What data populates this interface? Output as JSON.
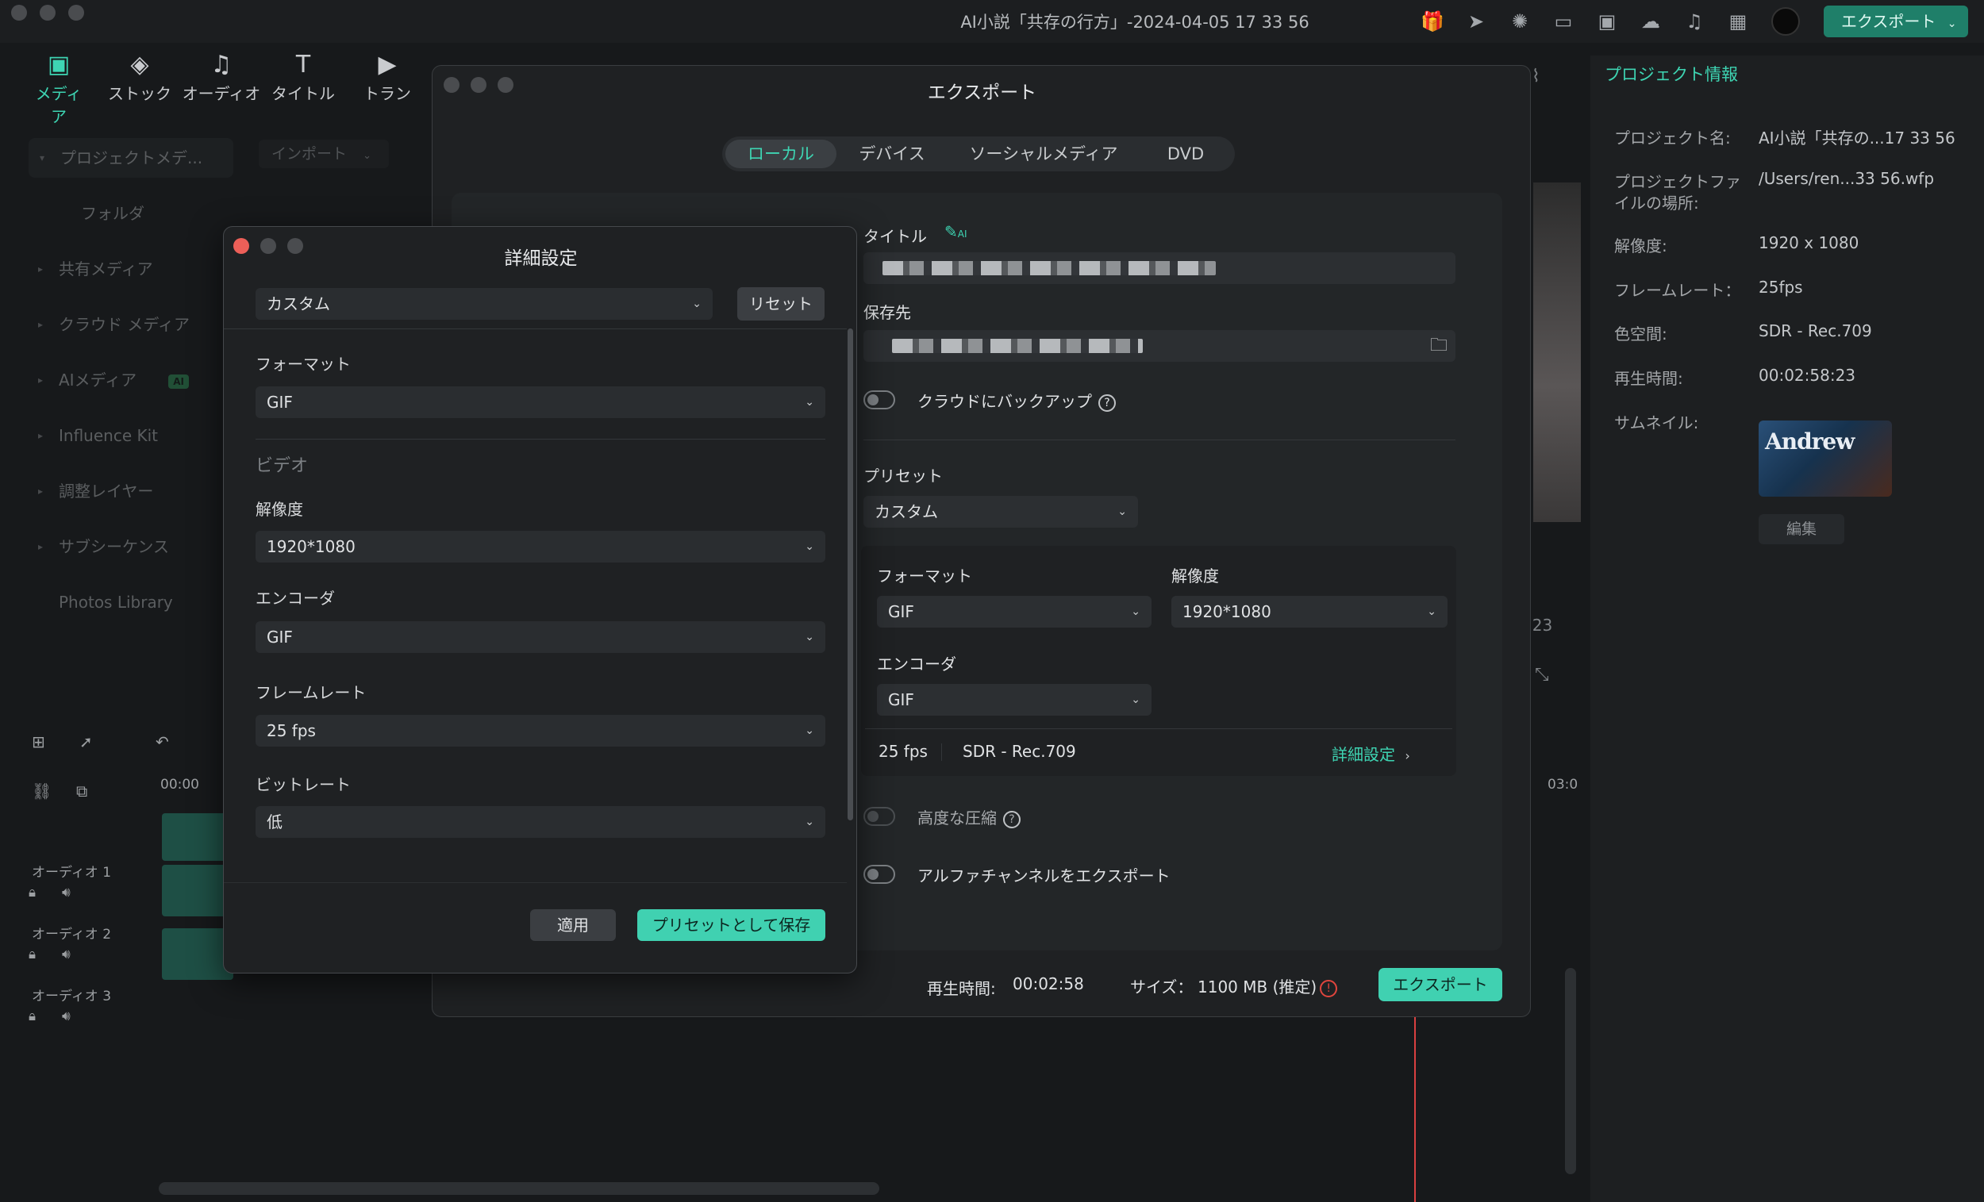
{
  "app": {
    "title": "AI小説「共存の行方」-2024-04-05 17 33 56",
    "export_button": "エクスポート",
    "toolbar": [
      {
        "label": "メディア",
        "icon": "media-icon"
      },
      {
        "label": "ストック",
        "icon": "stock-icon"
      },
      {
        "label": "オーディオ",
        "icon": "audio-icon"
      },
      {
        "label": "タイトル",
        "icon": "title-icon"
      },
      {
        "label": "トラン",
        "icon": "transition-icon"
      }
    ]
  },
  "left_panel": {
    "items": [
      "プロジェクトメデ...",
      "フォルダ",
      "共有メディア",
      "クラウド メディア",
      "AIメディア",
      "Influence Kit",
      "調整レイヤー",
      "サブシーケンス",
      "Photos Library"
    ],
    "ai_badge": "AI",
    "import_button": "インポート"
  },
  "right_panel": {
    "tab": "プロジェクト情報",
    "rows": [
      {
        "label": "プロジェクト名:",
        "value": "AI小説「共存の...17 33 56"
      },
      {
        "label": "プロジェクトファ",
        "value": "/Users/ren...33 56.wfp"
      },
      {
        "label": "イルの場所:",
        "value": ""
      },
      {
        "label": "解像度:",
        "value": "1920 x 1080"
      },
      {
        "label": "フレームレート：",
        "value": "25fps"
      },
      {
        "label": "色空間:",
        "value": "SDR - Rec.709"
      },
      {
        "label": "再生時間:",
        "value": "00:02:58:23"
      },
      {
        "label": "サムネイル:",
        "value": ""
      }
    ],
    "thumbnail_text": "Andrew",
    "edit_button": "編集",
    "preview_time": ":23"
  },
  "timeline": {
    "ruler_start": "00:00",
    "ruler_end": "03:0",
    "tracks": [
      "オーディオ 1",
      "オーディオ 2",
      "オーディオ 3"
    ]
  },
  "export_dialog": {
    "title": "エクスポート",
    "tabs": [
      "ローカル",
      "デバイス",
      "ソーシャルメディア",
      "DVD"
    ],
    "active_tab": 0,
    "title_label": "タイトル",
    "save_to_label": "保存先",
    "cloud_backup_label": "クラウドにバックアップ",
    "preset_label": "プリセット",
    "preset_value": "カスタム",
    "format_label": "フォーマット",
    "format_value": "GIF",
    "resolution_label": "解像度",
    "resolution_value": "1920*1080",
    "encoder_label": "エンコーダ",
    "encoder_value": "GIF",
    "summary_fps": "25 fps",
    "summary_color": "SDR - Rec.709",
    "detail_link": "詳細設定",
    "advanced_compression": "高度な圧縮",
    "alpha_export": "アルファチャンネルをエクスポート",
    "duration_label": "再生時間:",
    "duration_value": "00:02:58",
    "size_label": "サイズ：",
    "size_value": "1100 MB (推定)",
    "export_button": "エクスポート"
  },
  "detail_dialog": {
    "title": "詳細設定",
    "preset_value": "カスタム",
    "reset_button": "リセット",
    "format_label": "フォーマット",
    "format_value": "GIF",
    "video_section": "ビデオ",
    "resolution_label": "解像度",
    "resolution_value": "1920*1080",
    "encoder_label": "エンコーダ",
    "encoder_value": "GIF",
    "framerate_label": "フレームレート",
    "framerate_value": "25 fps",
    "bitrate_label": "ビットレート",
    "bitrate_value": "低",
    "apply_button": "適用",
    "save_preset_button": "プリセットとして保存"
  }
}
